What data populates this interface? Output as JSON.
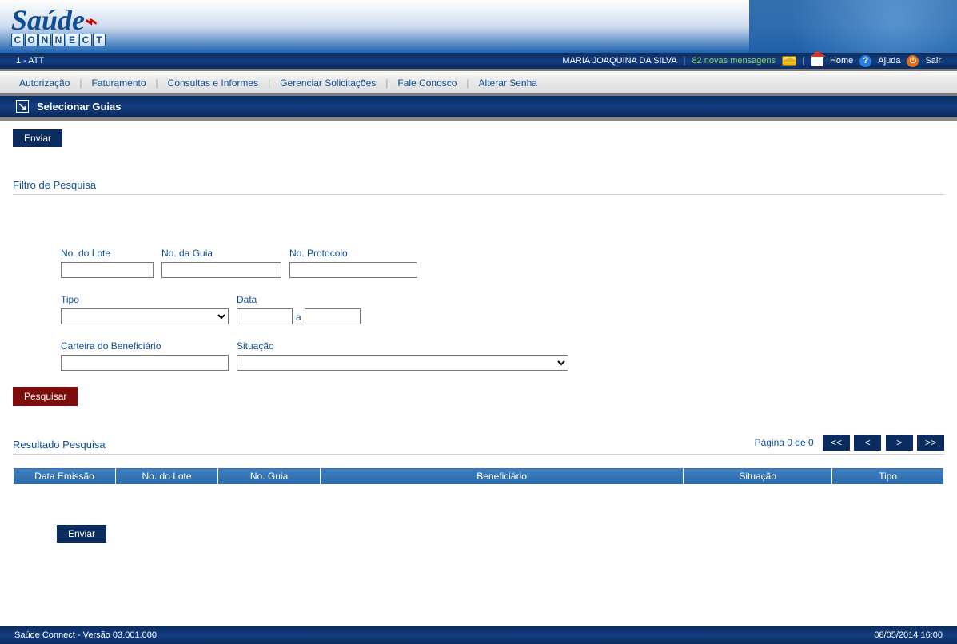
{
  "app": {
    "logo_main": "Saúde",
    "logo_sub": "CONNECT"
  },
  "topbar": {
    "left": "1 - ATT",
    "user": "MARIA JOAQUINA DA SILVA",
    "messages_label": "82 novas mensagens",
    "home": "Home",
    "help": "Ajuda",
    "exit": "Sair"
  },
  "menu": {
    "items": [
      "Autorização",
      "Faturamento",
      "Consultas e Informes",
      "Gerenciar Solicitações",
      "Fale Conosco",
      "Alterar Senha"
    ]
  },
  "page": {
    "title": "Selecionar Guias"
  },
  "buttons": {
    "enviar": "Enviar",
    "pesquisar": "Pesquisar",
    "enviar_bottom": "Enviar"
  },
  "filter": {
    "section_title": "Filtro de Pesquisa",
    "labels": {
      "lote": "No. do Lote",
      "guia": "No. da Guia",
      "protocolo": "No. Protocolo",
      "tipo": "Tipo",
      "data": "Data",
      "data_sep": "a",
      "carteira": "Carteira do Beneficiário",
      "situacao": "Situação"
    },
    "values": {
      "lote": "",
      "guia": "",
      "protocolo": "",
      "tipo": "",
      "data_de": "",
      "data_ate": "",
      "carteira": "",
      "situacao": ""
    }
  },
  "results": {
    "section_title": "Resultado Pesquisa",
    "pager_text": "Página 0 de 0",
    "pager": {
      "first": "<<",
      "prev": "<",
      "next": ">",
      "last": ">>"
    },
    "columns": [
      "Data Emissão",
      "No. do Lote",
      "No. Guia",
      "Beneficiário",
      "Situação",
      "Tipo"
    ],
    "rows": []
  },
  "footer": {
    "version": "Saúde Connect - Versão 03.001.000",
    "datetime": "08/05/2014 16:00"
  }
}
